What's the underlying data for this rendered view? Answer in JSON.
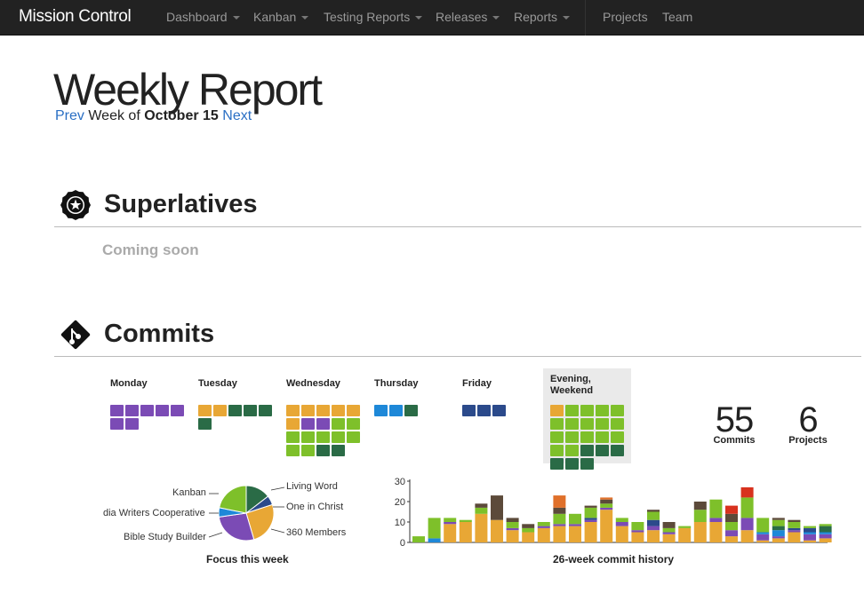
{
  "nav": {
    "brand": "Mission Control",
    "items": [
      {
        "label": "Dashboard",
        "dropdown": true
      },
      {
        "label": "Kanban",
        "dropdown": true
      },
      {
        "label": "Testing Reports",
        "dropdown": true
      },
      {
        "label": "Releases",
        "dropdown": true
      },
      {
        "label": "Reports",
        "dropdown": true
      },
      {
        "label": "Projects",
        "dropdown": false
      },
      {
        "label": "Team",
        "dropdown": false
      }
    ]
  },
  "header": {
    "title": "Weekly Report",
    "prev": "Prev",
    "week_of": "Week of",
    "week_date": "October 15",
    "next": "Next"
  },
  "superlatives": {
    "title": "Superlatives",
    "coming_soon": "Coming soon",
    "icon": "star-badge-icon"
  },
  "commits": {
    "title": "Commits",
    "icon": "git-icon",
    "colors": {
      "purple": "#7b4bb5",
      "orange": "#e8a735",
      "darkgreen": "#2a6b46",
      "green": "#7ec02a",
      "blue": "#1e88d8",
      "navy": "#2b4a8b"
    },
    "days": [
      {
        "label": "Monday",
        "squares": [
          "purple",
          "purple",
          "purple",
          "purple",
          "purple",
          "purple",
          "purple"
        ]
      },
      {
        "label": "Tuesday",
        "squares": [
          "orange",
          "orange",
          "darkgreen",
          "darkgreen",
          "darkgreen",
          "darkgreen"
        ]
      },
      {
        "label": "Wednesday",
        "squares": [
          "orange",
          "orange",
          "orange",
          "orange",
          "orange",
          "orange",
          "purple",
          "purple",
          "green",
          "green",
          "green",
          "green",
          "green",
          "green",
          "green",
          "green",
          "green",
          "darkgreen",
          "darkgreen"
        ]
      },
      {
        "label": "Thursday",
        "squares": [
          "blue",
          "blue",
          "darkgreen"
        ]
      },
      {
        "label": "Friday",
        "squares": [
          "navy",
          "navy",
          "navy"
        ]
      },
      {
        "label": "Evening, Weekend",
        "squares": [
          "orange",
          "green",
          "green",
          "green",
          "green",
          "green",
          "green",
          "green",
          "green",
          "green",
          "green",
          "green",
          "green",
          "green",
          "green",
          "green",
          "green",
          "darkgreen",
          "darkgreen",
          "darkgreen",
          "darkgreen",
          "darkgreen",
          "darkgreen"
        ]
      }
    ],
    "stats": [
      {
        "value": "55",
        "label": "Commits"
      },
      {
        "value": "6",
        "label": "Projects"
      }
    ]
  },
  "chart_data": [
    {
      "type": "pie",
      "title": "Focus this week",
      "slices": [
        {
          "label": "Living Word",
          "value": 8,
          "color": "#2a6b46"
        },
        {
          "label": "One in Christ",
          "value": 3,
          "color": "#2b4a8b"
        },
        {
          "label": "360 Members",
          "value": 14,
          "color": "#e8a735"
        },
        {
          "label": "Bible Study Builder",
          "value": 15,
          "color": "#7b4bb5"
        },
        {
          "label": "dia Writers Cooperative",
          "value": 3,
          "color": "#1e88d8"
        },
        {
          "label": "Kanban",
          "value": 12,
          "color": "#7ec02a"
        }
      ]
    },
    {
      "type": "bar",
      "stacked": true,
      "title": "26-week commit history",
      "ylim": [
        0,
        30
      ],
      "yticks": [
        0,
        10,
        20,
        30
      ],
      "series_colors": [
        "#e8a735",
        "#7b4bb5",
        "#1e88d8",
        "#2b4a8b",
        "#2a6b46",
        "#7ec02a",
        "#5c4a3a",
        "#e0702a",
        "#d8321e"
      ],
      "series_names": [
        "orange",
        "purple",
        "blue",
        "navy",
        "darkgreen",
        "green",
        "brown",
        "darkorange",
        "red"
      ],
      "bars": [
        [
          0,
          0,
          0,
          0,
          0,
          3,
          0,
          0,
          0
        ],
        [
          0,
          0,
          2,
          0,
          0,
          10,
          0,
          0,
          0
        ],
        [
          9,
          1,
          0,
          0,
          0,
          2,
          0,
          0,
          0
        ],
        [
          10,
          0,
          0,
          0,
          0,
          1,
          0,
          0,
          0
        ],
        [
          14,
          0,
          0,
          0,
          0,
          3,
          2,
          0,
          0
        ],
        [
          11,
          0,
          0,
          0,
          0,
          0,
          12,
          0,
          0
        ],
        [
          6,
          1,
          0,
          0,
          0,
          3,
          2,
          0,
          0
        ],
        [
          5,
          0,
          0,
          0,
          0,
          2,
          2,
          0,
          0
        ],
        [
          7,
          1,
          0,
          0,
          0,
          2,
          0,
          0,
          0
        ],
        [
          8,
          1,
          0,
          0,
          0,
          5,
          3,
          6,
          0
        ],
        [
          8,
          1,
          0,
          0,
          0,
          5,
          0,
          0,
          0
        ],
        [
          10,
          1,
          0,
          1,
          0,
          5,
          1,
          0,
          0
        ],
        [
          16,
          1,
          0,
          0,
          0,
          2,
          2,
          1,
          0
        ],
        [
          8,
          2,
          0,
          0,
          0,
          2,
          0,
          0,
          0
        ],
        [
          5,
          1,
          0,
          0,
          0,
          4,
          0,
          0,
          0
        ],
        [
          6,
          2,
          0,
          3,
          0,
          4,
          1,
          0,
          0
        ],
        [
          4,
          1,
          0,
          0,
          0,
          2,
          3,
          0,
          0
        ],
        [
          7,
          0,
          0,
          0,
          0,
          1,
          0,
          0,
          0
        ],
        [
          10,
          0,
          0,
          0,
          0,
          6,
          4,
          0,
          0
        ],
        [
          10,
          2,
          0,
          0,
          0,
          9,
          0,
          0,
          0
        ],
        [
          3,
          3,
          0,
          0,
          0,
          4,
          4,
          0,
          4
        ],
        [
          6,
          6,
          0,
          0,
          0,
          10,
          0,
          0,
          5
        ],
        [
          1,
          3,
          1,
          0,
          0,
          7,
          0,
          0,
          0
        ],
        [
          2,
          1,
          3,
          0,
          2,
          3,
          1,
          0,
          0
        ],
        [
          5,
          1,
          0,
          1,
          0,
          3,
          1,
          0,
          0
        ],
        [
          1,
          3,
          1,
          2,
          0,
          1,
          0,
          0,
          0
        ],
        [
          2,
          2,
          1,
          0,
          3,
          1,
          0,
          0,
          0
        ]
      ]
    }
  ]
}
